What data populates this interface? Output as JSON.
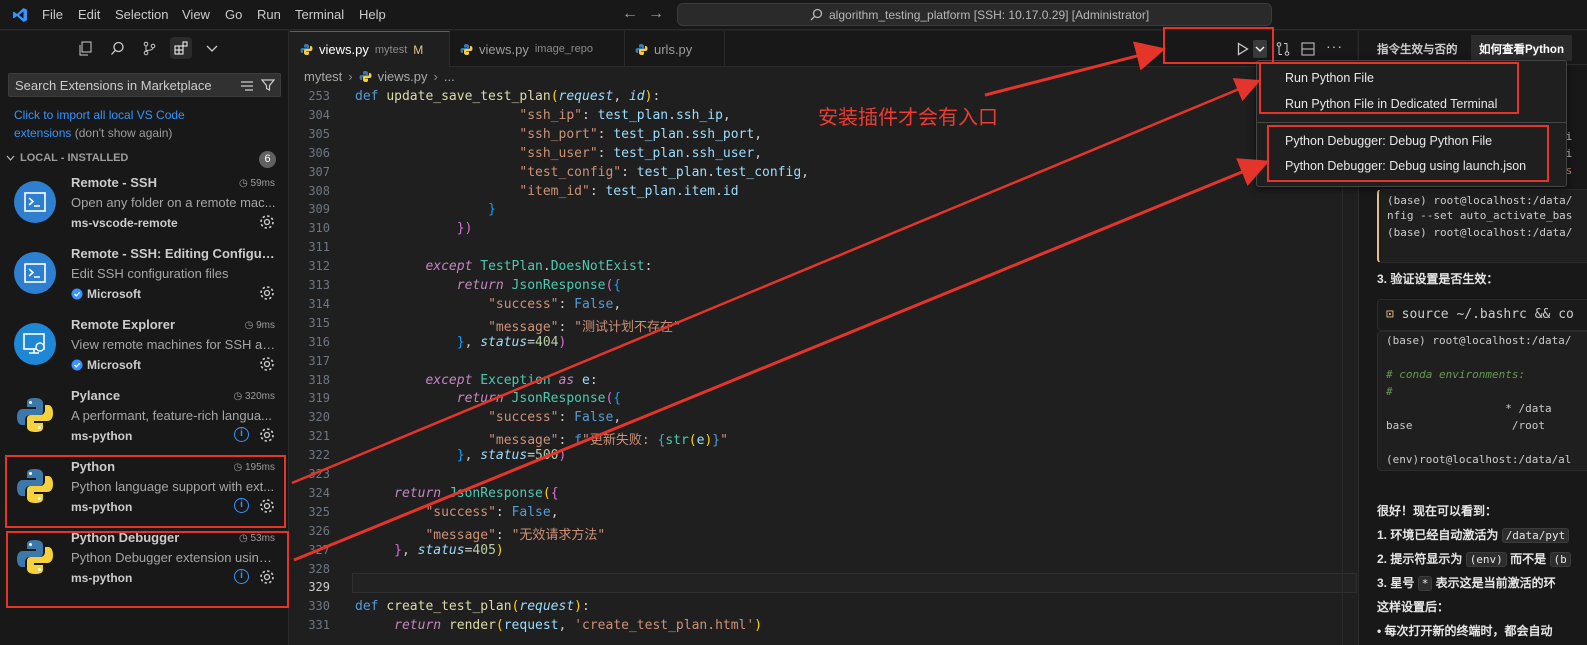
{
  "titlebar": {
    "menus": [
      "File",
      "Edit",
      "Selection",
      "View",
      "Go",
      "Run",
      "Terminal",
      "Help"
    ],
    "command_center": "algorithm_testing_platform [SSH: 10.17.0.29] [Administrator]"
  },
  "sidebar": {
    "search_placeholder": "Search Extensions in Marketplace",
    "import_link": "Click to import all local VS Code extensions",
    "import_dismiss": "(don't show again)",
    "section_title": "LOCAL - INSTALLED",
    "section_count": "6",
    "extensions": [
      {
        "name": "Remote - SSH",
        "desc": "Open any folder on a remote mac...",
        "publisher": "ms-vscode-remote",
        "time": "59ms",
        "verified": false,
        "info": false
      },
      {
        "name": "Remote - SSH: Editing Configur...",
        "desc": "Edit SSH configuration files",
        "publisher": "Microsoft",
        "time": "",
        "verified": true,
        "info": false
      },
      {
        "name": "Remote Explorer",
        "desc": "View remote machines for SSH an...",
        "publisher": "Microsoft",
        "time": "9ms",
        "verified": true,
        "info": false
      },
      {
        "name": "Pylance",
        "desc": "A performant, feature-rich langua...",
        "publisher": "ms-python",
        "time": "320ms",
        "verified": false,
        "info": true
      },
      {
        "name": "Python",
        "desc": "Python language support with ext...",
        "publisher": "ms-python",
        "time": "195ms",
        "verified": false,
        "info": true
      },
      {
        "name": "Python Debugger",
        "desc": "Python Debugger extension using ...",
        "publisher": "ms-python",
        "time": "53ms",
        "verified": false,
        "info": true
      }
    ]
  },
  "editor": {
    "tabs": [
      {
        "label": "views.py",
        "sub": "mytest",
        "badge": "M"
      },
      {
        "label": "views.py",
        "sub": "image_repo",
        "badge": ""
      },
      {
        "label": "urls.py",
        "sub": "",
        "badge": ""
      }
    ],
    "breadcrumb": [
      "mytest",
      "views.py",
      "..."
    ],
    "line_numbers": [
      "253",
      "304",
      "305",
      "306",
      "307",
      "308",
      "309",
      "310",
      "311",
      "312",
      "313",
      "314",
      "315",
      "316",
      "317",
      "318",
      "319",
      "320",
      "321",
      "322",
      "323",
      "324",
      "325",
      "326",
      "327",
      "328",
      "329",
      "330",
      "331"
    ]
  },
  "run_menu": {
    "items": [
      "Run Python File",
      "Run Python File in Dedicated Terminal",
      "Python Debugger: Debug Python File",
      "Python Debugger: Debug using launch.json"
    ]
  },
  "annotation": "安装插件才会有入口",
  "chat": {
    "tabs": [
      "指令生效与否的",
      "如何查看Python"
    ],
    "lines_right": [
      "vi",
      "-i",
      "is"
    ],
    "term1": [
      "(base) root@localhost:/data/",
      "nfig --set auto_activate_bas",
      "(base) root@localhost:/data/"
    ],
    "step3": "3. 验证设置是否生效：",
    "cmd": "source ~/.bashrc && co",
    "term2": [
      "(base) root@localhost:/data/",
      "",
      "# conda environments:",
      "#",
      "                  * /data",
      "base               /root",
      "",
      "(env)root@localhost:/data/al"
    ],
    "good": "很好！现在可以看到：",
    "item1": "1. 环境已经自动激活为",
    "item1_chip": "/data/pyt",
    "item2": "2. 提示符显示为",
    "item2_chip": "(env)",
    "item2_tail": "而不是",
    "item2_chip2": "(b",
    "item3": "3. 星号",
    "item3_chip": "*",
    "item3_tail": "表示这是当前激活的环",
    "after": "这样设置后：",
    "bullet": "每次打开新的终端时，都会自动"
  },
  "colors": {
    "accent": "#0078d4",
    "annotation_red": "#e5352b",
    "bg": "#1f1f1f",
    "sidebar_bg": "#181818"
  }
}
